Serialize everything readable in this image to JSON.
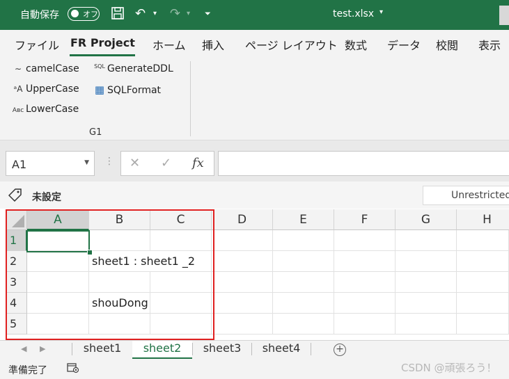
{
  "titlebar": {
    "autosave_label": "自動保存",
    "toggle_state": "オフ",
    "filename": "test.xlsx",
    "filename_dropdown": "▾",
    "save_icon": "💾",
    "undo_icon": "↶",
    "redo_icon": "↷",
    "customize_icon": "⏷"
  },
  "menu": {
    "items": [
      "ファイル",
      "FR Project",
      "ホーム",
      "挿入",
      "ページ レイアウト",
      "数式",
      "データ",
      "校閲",
      "表示"
    ],
    "active": "FR Project"
  },
  "ribbon": {
    "buttons": [
      {
        "label": "camelCase",
        "icon": "camel-case-icon",
        "glyph": "∼"
      },
      {
        "label": "UpperCase",
        "icon": "upper-case-icon",
        "glyph": "ᵃA"
      },
      {
        "label": "LowerCase",
        "icon": "lower-case-icon",
        "glyph": "Aʙᴄ"
      },
      {
        "label": "GenerateDDL",
        "icon": "sql-icon",
        "glyph": "SQL"
      },
      {
        "label": "SQLFormat",
        "icon": "sql-format-icon",
        "glyph": "▦"
      }
    ],
    "group_label": "G1"
  },
  "formula_bar": {
    "name_box": "A1",
    "cancel_icon": "✕",
    "enter_icon": "✓",
    "fx_label": "fx",
    "formula": ""
  },
  "info_bar": {
    "sensitivity_label": "未設定",
    "restriction": "Unrestricted"
  },
  "grid": {
    "columns": [
      "A",
      "B",
      "C",
      "D",
      "E",
      "F",
      "G",
      "H"
    ],
    "rows": [
      "1",
      "2",
      "3",
      "4",
      "5"
    ],
    "selected_cell": "A1",
    "cells": [
      {
        "row": 2,
        "col": "B",
        "value": "sheet1 : sheet1 _2"
      },
      {
        "row": 4,
        "col": "B",
        "value": "shouDong"
      }
    ]
  },
  "sheets": {
    "tabs": [
      "sheet1",
      "sheet2",
      "sheet3",
      "sheet4"
    ],
    "active": "sheet2",
    "add_icon": "+"
  },
  "status": {
    "text": "準備完了",
    "watermark": "CSDN @頑張ろう！"
  },
  "colors": {
    "accent": "#217346",
    "highlight_box": "#e02020"
  }
}
